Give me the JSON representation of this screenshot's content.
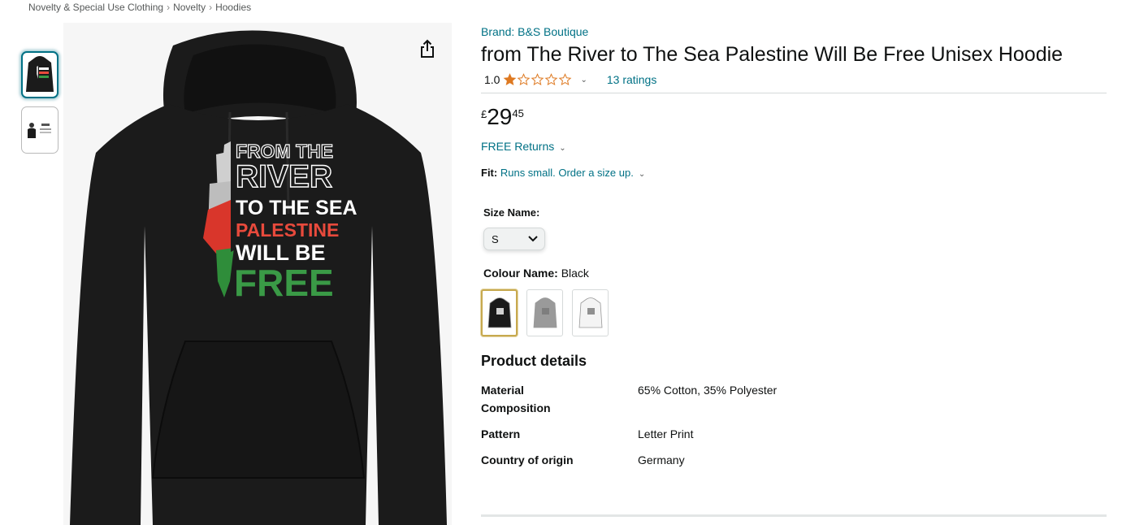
{
  "breadcrumb": [
    "Novelty & Special Use Clothing",
    "Novelty",
    "Hoodies"
  ],
  "breadcrumb_separator": "›",
  "gallery": {
    "print_lines": [
      "FROM THE",
      "RIVER",
      "TO THE SEA",
      "PALESTINE",
      "WILL BE",
      "FREE"
    ],
    "share_icon": "share-icon"
  },
  "product": {
    "brand": "Brand: B&S Boutique",
    "title": "from The River to The Sea Palestine Will Be Free Unisex Hoodie",
    "rating_value": "1.0",
    "rating_stars": 1,
    "ratings_count": "13 ratings",
    "price": {
      "symbol": "£",
      "whole": "29",
      "fraction": "45"
    },
    "free_returns": "FREE Returns",
    "fit_label": "Fit:",
    "fit_value": "Runs small. Order a size up.",
    "size_label": "Size Name:",
    "size_selected": "S",
    "colour_label": "Colour Name:",
    "colour_value": "Black",
    "swatches": [
      {
        "name": "black",
        "color": "#1a1a1a"
      },
      {
        "name": "grey",
        "color": "#9a9a9a"
      },
      {
        "name": "white",
        "color": "#f4f4f4"
      }
    ]
  },
  "details": {
    "heading": "Product details",
    "rows": [
      {
        "key": "Material Composition",
        "value": "65% Cotton, 35% Polyester"
      },
      {
        "key": "Pattern",
        "value": "Letter Print"
      },
      {
        "key": "Country of origin",
        "value": "Germany"
      }
    ]
  },
  "colors": {
    "link": "#007185",
    "star": "#de7921",
    "hoodie": "#1b1b1b",
    "flag_red": "#d9362b",
    "flag_green": "#2f8d3a"
  }
}
